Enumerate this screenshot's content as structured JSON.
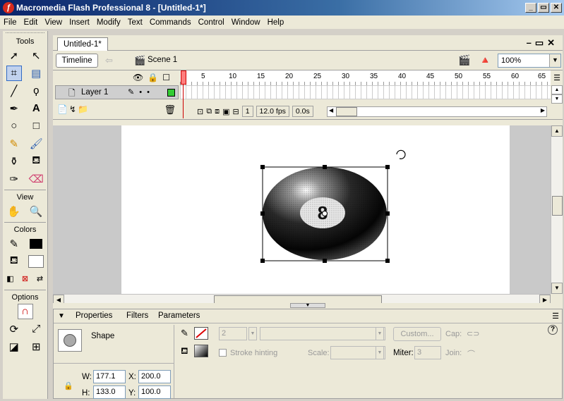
{
  "window": {
    "title": "Macromedia Flash Professional 8 - [Untitled-1*]",
    "buttons": [
      "_",
      " ̲",
      "X"
    ]
  },
  "menubar": [
    "File",
    "Edit",
    "View",
    "Insert",
    "Modify",
    "Text",
    "Commands",
    "Control",
    "Window",
    "Help"
  ],
  "tools": {
    "header": "Tools",
    "view_label": "View",
    "colors_label": "Colors",
    "options_label": "Options",
    "fill_color": "#000000",
    "stroke_color": "#000000"
  },
  "document": {
    "tab": "Untitled-1*",
    "timeline_button": "Timeline",
    "scene": "Scene 1",
    "zoom": "100%"
  },
  "timeline": {
    "layer_name": "Layer 1",
    "frame_numbers": [
      "1",
      "5",
      "10",
      "15",
      "20",
      "25",
      "30",
      "35",
      "40",
      "45",
      "50",
      "55",
      "60",
      "65"
    ],
    "current_frame": "1",
    "fps": "12.0 fps",
    "time": "0.0s"
  },
  "properties": {
    "tabs": [
      "Properties",
      "Filters",
      "Parameters"
    ],
    "type": "Shape",
    "stroke_height": "2",
    "custom_button": "Custom...",
    "cap_label": "Cap:",
    "join_label": "Join:",
    "stroke_hinting": "Stroke hinting",
    "scale_label": "Scale:",
    "miter_label": "Miter:",
    "miter": "3",
    "w_label": "W:",
    "w": "177.1",
    "x_label": "X:",
    "x": "200.0",
    "h_label": "H:",
    "h": "133.0",
    "y_label": "Y:",
    "y": "100.0"
  },
  "stage": {
    "ball_number": "8"
  }
}
